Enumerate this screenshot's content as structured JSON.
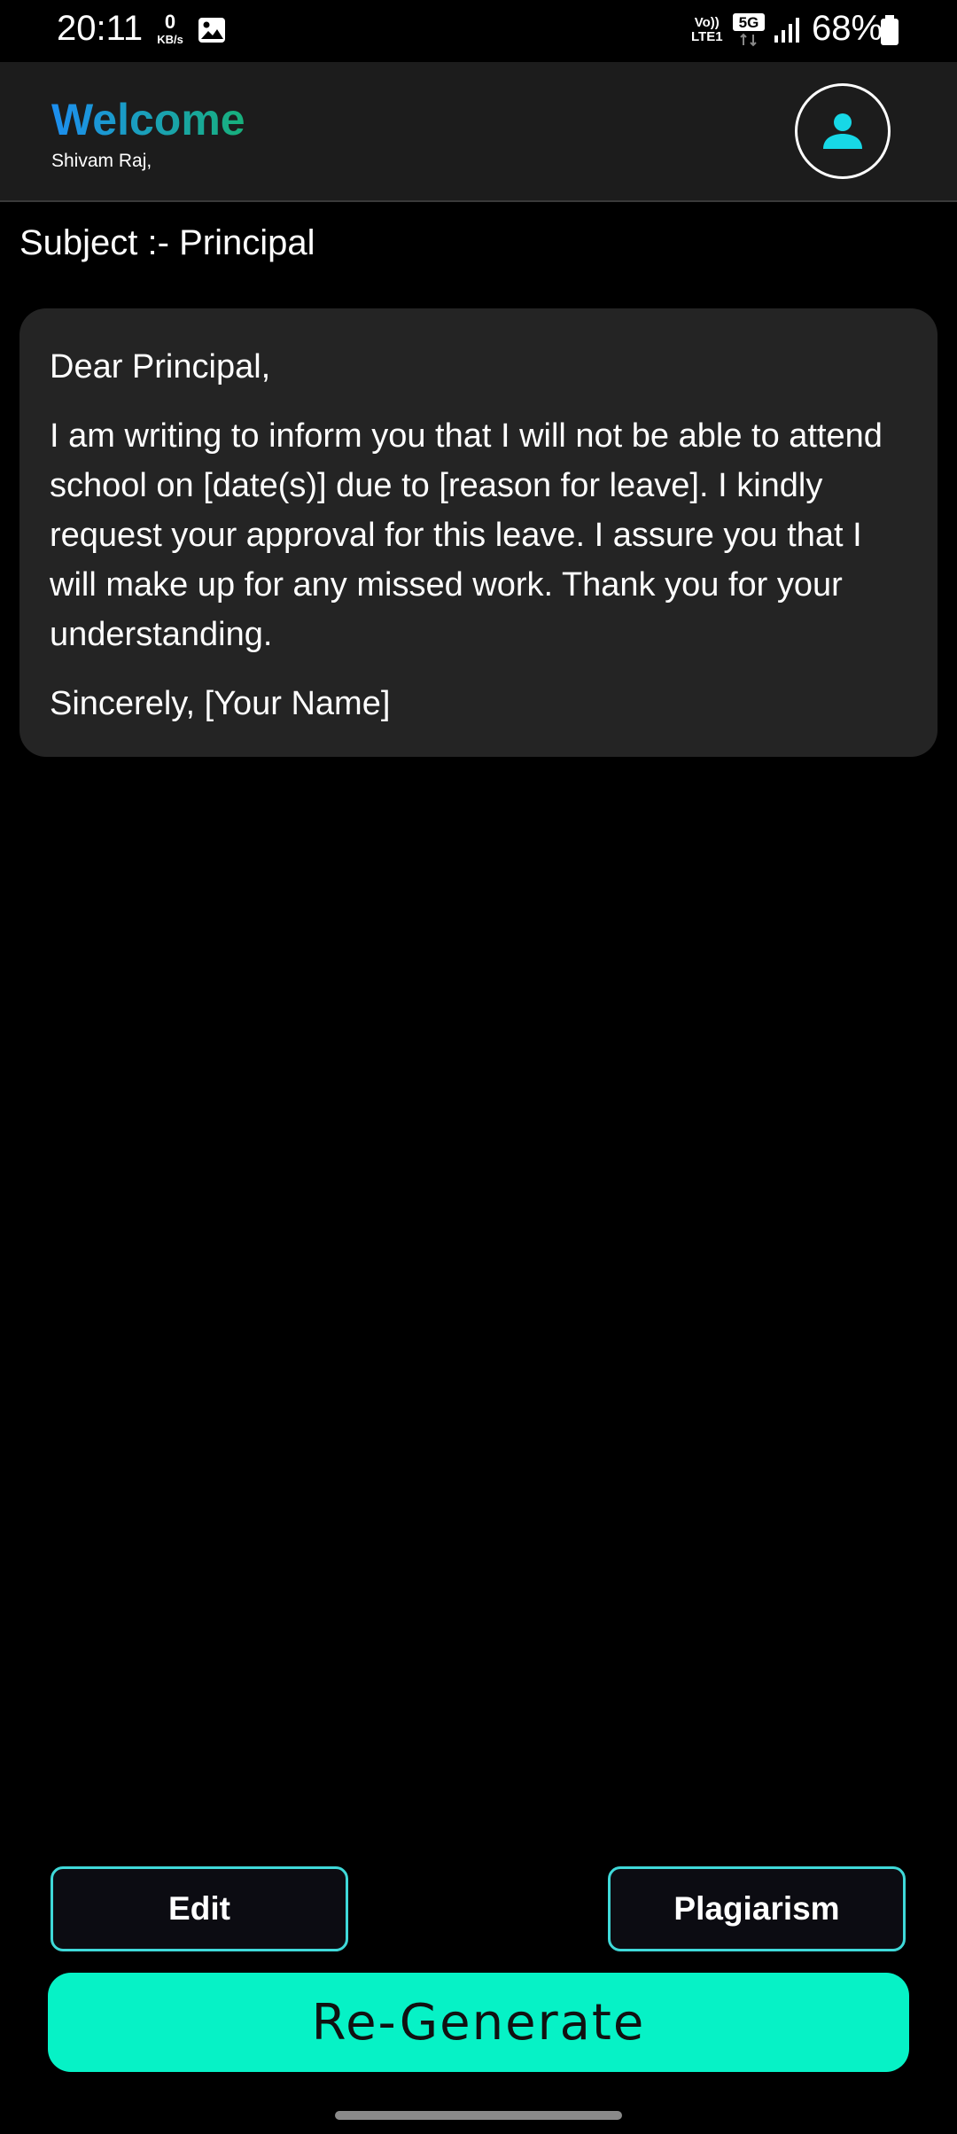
{
  "status_bar": {
    "time": "20:11",
    "net_speed_value": "0",
    "net_speed_unit": "KB/s",
    "volte_top": "Vo))",
    "volte_bottom": "LTE1",
    "network_type": "5G",
    "battery_percent": "68%",
    "icons": [
      "gallery-icon",
      "signal-icon",
      "battery-icon"
    ]
  },
  "header": {
    "title": "Welcome",
    "user_name": "Shivam Raj,",
    "avatar_icon": "person-icon",
    "title_gradient": [
      "#1c8ef0",
      "#17b07a"
    ],
    "avatar_icon_color": "#17d8e6"
  },
  "subject": {
    "text": "Subject :- Principal"
  },
  "letter": {
    "greeting": "Dear Principal,",
    "body": "I am writing to inform you that I will not be able to attend school on [date(s)] due to [reason for leave]. I kindly request your approval for this leave. I assure you that I will make up for any missed work. Thank you for your understanding.",
    "closing": "Sincerely, [Your Name]"
  },
  "actions": {
    "edit_label": "Edit",
    "plagiarism_label": "Plagiarism",
    "regenerate_label": "Re-Generate",
    "accent_color": "#06f2c6",
    "outline_color": "#3fd9d9"
  }
}
